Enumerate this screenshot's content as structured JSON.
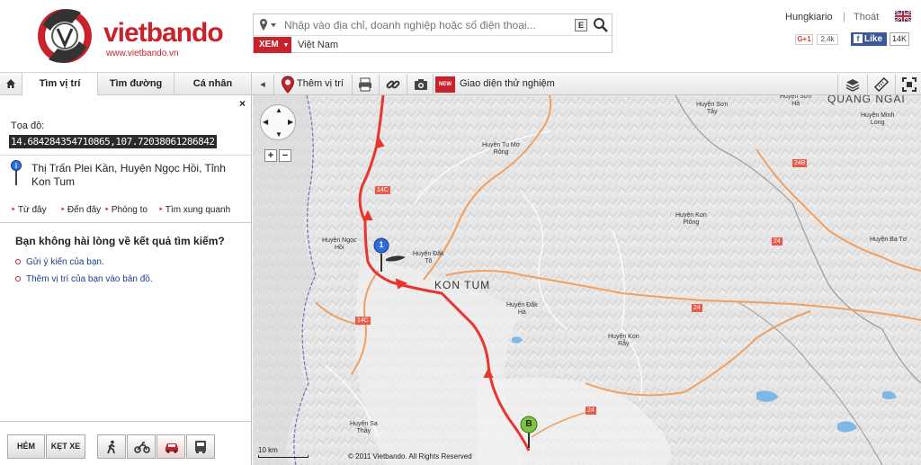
{
  "header": {
    "logo_text": "vietbando",
    "logo_url": "www.vietbando.vn",
    "search_placeholder": "Nhập vào địa chỉ, doanh nghiệp hoặc số điện thoại...",
    "keyboard_key": "E",
    "view_button": "XEM",
    "country": "Việt Nam",
    "user_name": "Hungkiario",
    "separator": "|",
    "logout": "Thoát",
    "gplus_label": "G+1",
    "gplus_count": "2.4k",
    "fb_like": "Like",
    "fb_count": "14K"
  },
  "toolbar": {
    "tabs": [
      {
        "label": "Tìm vị trí"
      },
      {
        "label": "Tìm đường"
      },
      {
        "label": "Cá nhân"
      }
    ],
    "add_location": "Thêm vị trí",
    "new_badge": "NEW",
    "trial_interface": "Giao diện thử nghiệm"
  },
  "panel": {
    "close": "×",
    "coord_label": "Tọa độ:",
    "coord_value": "14.684284354710865,107.72038061286842",
    "address": "Thị Trấn Plei Kần, Huyện Ngọc Hồi, Tỉnh Kon Tum",
    "actions": [
      "Từ đây",
      "Đến đây",
      "Phóng to",
      "Tìm xung quanh"
    ],
    "question": "Bạn không hài lòng về kết quả tìm kiếm?",
    "feedback_link": "Gửi ý kiến của bạn.",
    "add_map_link": "Thêm vị trí của bạn vào bản đồ.",
    "footer": {
      "alley_button": "HẺM",
      "traffic_button": "KẸT XE"
    }
  },
  "map": {
    "city": "KON TUM",
    "province": "QUẢNG NGÃI",
    "places": [
      {
        "name": "Huyện Sơn\nTây"
      },
      {
        "name": "Huyện Sơn\nHà"
      },
      {
        "name": "Huyện Minh\nLong"
      },
      {
        "name": "Huyện Tu Mơ\nRông"
      },
      {
        "name": "Huyện Kon\nPlông"
      },
      {
        "name": "Huyện Ngọc\nHồi"
      },
      {
        "name": "Huyện Đăk\nTô"
      },
      {
        "name": "Huyện Ba Tơ"
      },
      {
        "name": "Huyện Đăk\nHà"
      },
      {
        "name": "Huyện Kon\nRẫy"
      },
      {
        "name": "Huyện Sa\nThầy"
      }
    ],
    "road_tags": [
      "24B",
      "24",
      "24",
      "24",
      "14C",
      "14C"
    ],
    "marker_b": "B",
    "marker_1": "1",
    "scale": "10 km",
    "copyright": "© 2011 Vietbando. All Rights Reserved"
  },
  "colors": {
    "brand_red": "#c8232c",
    "route_red": "#e8352e",
    "road_orange": "#f0a060",
    "border_purple": "#8a6db0"
  }
}
